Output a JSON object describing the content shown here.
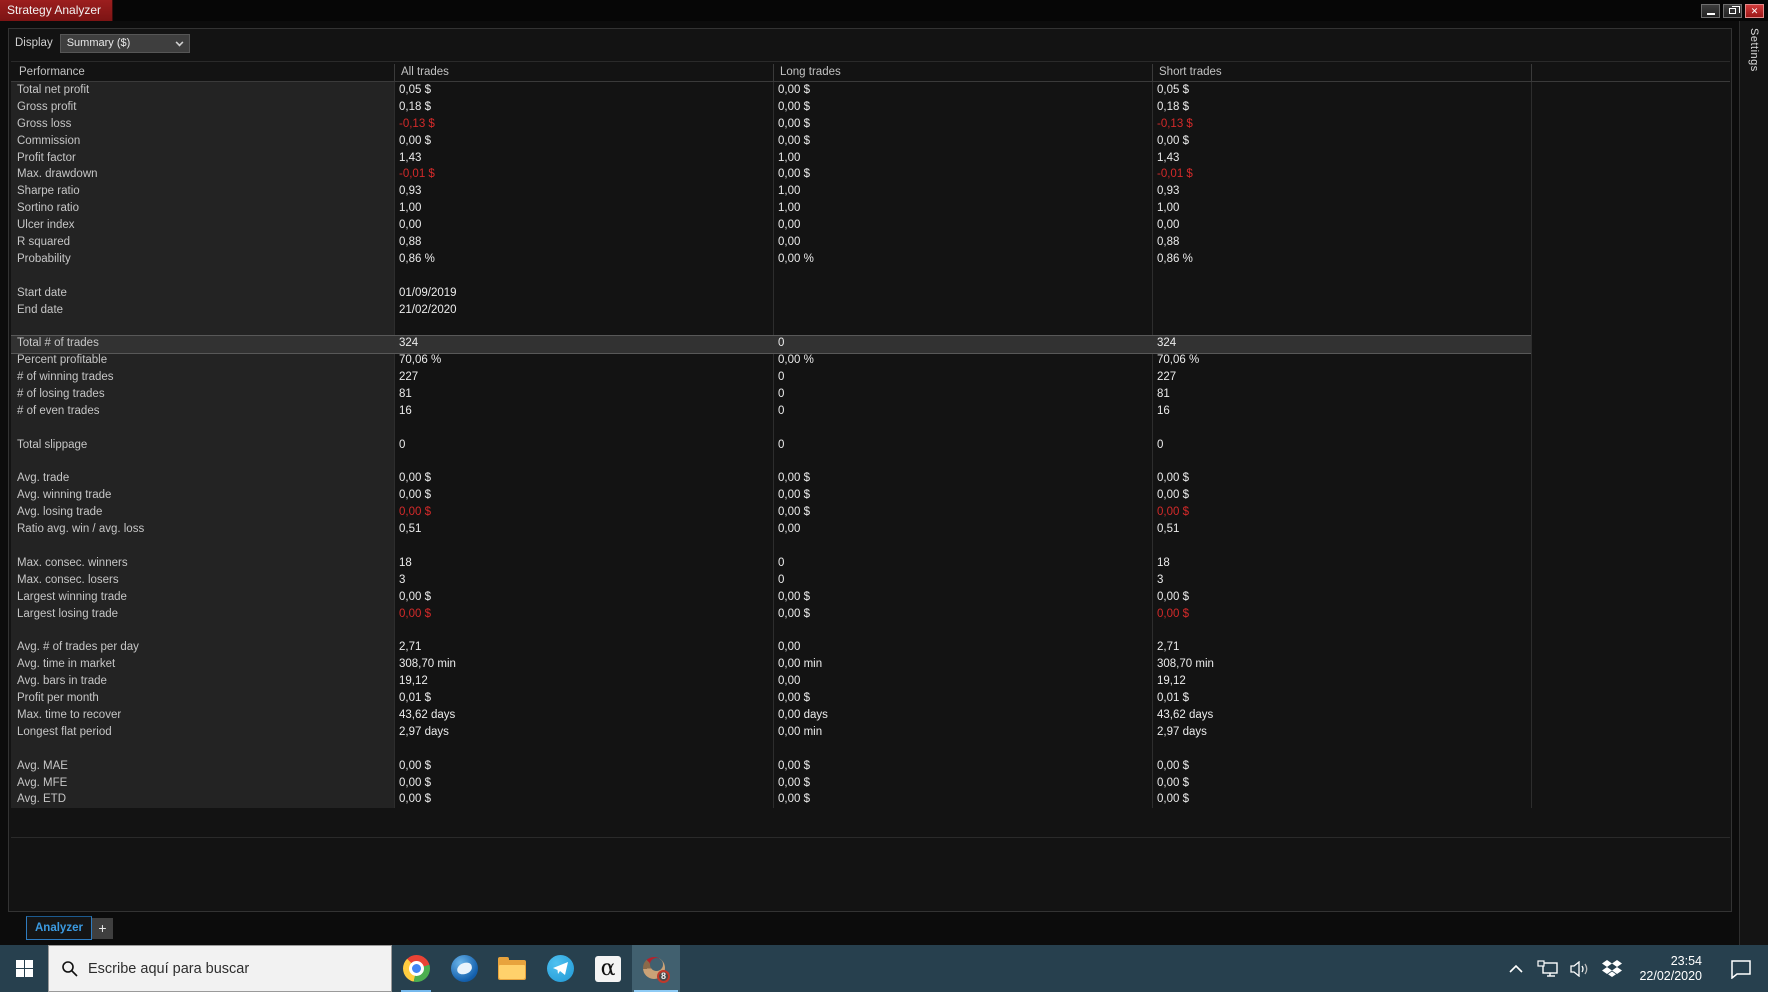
{
  "window": {
    "title": "Strategy Analyzer",
    "settings_tab": "Settings",
    "accent_red": "#8f1a1a",
    "negative_color": "#d42a2a",
    "link_blue": "#3b9ae1"
  },
  "toolbar": {
    "display_label": "Display",
    "display_value": "Summary ($)"
  },
  "table": {
    "columns": [
      "Performance",
      "All trades",
      "Long trades",
      "Short trades"
    ],
    "rows": [
      {
        "label": "Total net profit",
        "all": "0,05 $",
        "long": "0,00 $",
        "short": "0,05 $"
      },
      {
        "label": "Gross profit",
        "all": "0,18 $",
        "long": "0,00 $",
        "short": "0,18 $"
      },
      {
        "label": "Gross loss",
        "all": "-0,13 $",
        "long": "0,00 $",
        "short": "-0,13 $",
        "neg": [
          "all",
          "short"
        ]
      },
      {
        "label": "Commission",
        "all": "0,00 $",
        "long": "0,00 $",
        "short": "0,00 $"
      },
      {
        "label": "Profit factor",
        "all": "1,43",
        "long": "1,00",
        "short": "1,43"
      },
      {
        "label": "Max. drawdown",
        "all": "-0,01 $",
        "long": "0,00 $",
        "short": "-0,01 $",
        "neg": [
          "all",
          "short"
        ]
      },
      {
        "label": "Sharpe ratio",
        "all": "0,93",
        "long": "1,00",
        "short": "0,93"
      },
      {
        "label": "Sortino ratio",
        "all": "1,00",
        "long": "1,00",
        "short": "1,00"
      },
      {
        "label": "Ulcer index",
        "all": "0,00",
        "long": "0,00",
        "short": "0,00"
      },
      {
        "label": "R squared",
        "all": "0,88",
        "long": "0,00",
        "short": "0,88"
      },
      {
        "label": "Probability",
        "all": "0,86 %",
        "long": "0,00 %",
        "short": "0,86 %"
      },
      {
        "blank": true
      },
      {
        "label": "Start date",
        "all": "01/09/2019",
        "long": "",
        "short": ""
      },
      {
        "label": "End date",
        "all": "21/02/2020",
        "long": "",
        "short": ""
      },
      {
        "blank": true
      },
      {
        "label": "Total # of trades",
        "all": "324",
        "long": "0",
        "short": "324",
        "selected": true
      },
      {
        "label": "Percent profitable",
        "all": "70,06 %",
        "long": "0,00 %",
        "short": "70,06 %"
      },
      {
        "label": "# of winning trades",
        "all": "227",
        "long": "0",
        "short": "227"
      },
      {
        "label": "# of losing trades",
        "all": "81",
        "long": "0",
        "short": "81"
      },
      {
        "label": "# of even trades",
        "all": "16",
        "long": "0",
        "short": "16"
      },
      {
        "blank": true
      },
      {
        "label": "Total slippage",
        "all": "0",
        "long": "0",
        "short": "0"
      },
      {
        "blank": true
      },
      {
        "label": "Avg. trade",
        "all": "0,00 $",
        "long": "0,00 $",
        "short": "0,00 $"
      },
      {
        "label": "Avg. winning trade",
        "all": "0,00 $",
        "long": "0,00 $",
        "short": "0,00 $"
      },
      {
        "label": "Avg. losing trade",
        "all": "0,00 $",
        "long": "0,00 $",
        "short": "0,00 $",
        "neg": [
          "all",
          "short"
        ]
      },
      {
        "label": "Ratio avg. win / avg. loss",
        "all": "0,51",
        "long": "0,00",
        "short": "0,51"
      },
      {
        "blank": true
      },
      {
        "label": "Max. consec. winners",
        "all": "18",
        "long": "0",
        "short": "18"
      },
      {
        "label": "Max. consec. losers",
        "all": "3",
        "long": "0",
        "short": "3"
      },
      {
        "label": "Largest winning trade",
        "all": "0,00 $",
        "long": "0,00 $",
        "short": "0,00 $"
      },
      {
        "label": "Largest losing trade",
        "all": "0,00 $",
        "long": "0,00 $",
        "short": "0,00 $",
        "neg": [
          "all",
          "short"
        ]
      },
      {
        "blank": true
      },
      {
        "label": "Avg. # of trades per day",
        "all": "2,71",
        "long": "0,00",
        "short": "2,71"
      },
      {
        "label": "Avg. time in market",
        "all": "308,70 min",
        "long": "0,00 min",
        "short": "308,70 min"
      },
      {
        "label": "Avg. bars in trade",
        "all": "19,12",
        "long": "0,00",
        "short": "19,12"
      },
      {
        "label": "Profit per month",
        "all": "0,01 $",
        "long": "0,00 $",
        "short": "0,01 $"
      },
      {
        "label": "Max. time to recover",
        "all": "43,62 days",
        "long": "0,00 days",
        "short": "43,62 days"
      },
      {
        "label": "Longest flat period",
        "all": "2,97 days",
        "long": "0,00 min",
        "short": "2,97 days"
      },
      {
        "blank": true
      },
      {
        "label": "Avg. MAE",
        "all": "0,00 $",
        "long": "0,00 $",
        "short": "0,00 $"
      },
      {
        "label": "Avg. MFE",
        "all": "0,00 $",
        "long": "0,00 $",
        "short": "0,00 $"
      },
      {
        "label": "Avg. ETD",
        "all": "0,00 $",
        "long": "0,00 $",
        "short": "0,00 $"
      }
    ]
  },
  "tabs": {
    "analyzer": "Analyzer",
    "add": "+"
  },
  "taskbar": {
    "search_placeholder": "Escribe aquí para buscar",
    "app_icons": [
      "chrome",
      "thunderbird",
      "file-explorer",
      "telegram",
      "alpha-app",
      "ninjatrader"
    ],
    "alpha_glyph": "α",
    "ninjatrader_badge": "8",
    "clock_time": "23:54",
    "clock_date": "22/02/2020"
  }
}
